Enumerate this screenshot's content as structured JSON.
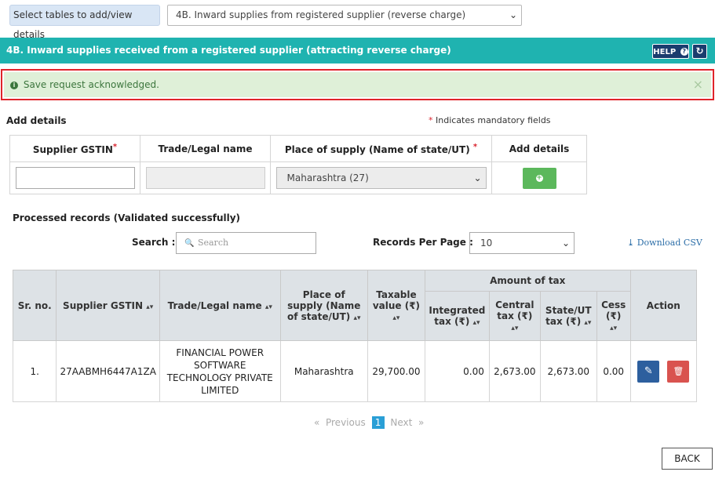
{
  "table_selector": {
    "label": "Select tables to add/view details",
    "selected": "4B. Inward supplies from registered supplier (reverse charge)"
  },
  "header": {
    "title": "4B. Inward supplies received from a registered supplier (attracting reverse charge)",
    "help_label": "HELP",
    "help_icon_glyph": "?",
    "refresh_glyph": "↻"
  },
  "alert": {
    "icon_glyph": "i",
    "message": "Save request acknowledged.",
    "close_glyph": "×"
  },
  "add_section": {
    "title": "Add details",
    "mandatory_star": "*",
    "mandatory_note": "Indicates mandatory fields",
    "columns": {
      "supplier_gstin": "Supplier GSTIN",
      "trade_name": "Trade/Legal name",
      "place_of_supply": "Place of supply (Name of state/UT)",
      "add_details": "Add details"
    },
    "supplier_gstin_value": "",
    "trade_name_value": "",
    "place_of_supply_selected": "Maharashtra (27)",
    "add_glyph": "+"
  },
  "processed": {
    "title": "Processed records (Validated successfully)",
    "search_label": "Search :",
    "search_placeholder": "Search",
    "search_glyph": "🔍",
    "rpp_label": "Records Per Page :",
    "rpp_selected": "10",
    "download_label": "Download CSV",
    "download_glyph": "⤓",
    "sort_glyph": "▴▾",
    "columns": {
      "sr_no": "Sr. no.",
      "supplier_gstin": "Supplier GSTIN",
      "trade_name": "Trade/Legal name",
      "place_of_supply": "Place of supply (Name of state/UT)",
      "taxable_value": "Taxable value (₹)",
      "amount_of_tax": "Amount of tax",
      "integrated_tax": "Integrated tax (₹)",
      "central_tax": "Central tax (₹)",
      "state_ut_tax": "State/UT tax (₹)",
      "cess": "Cess (₹)",
      "action": "Action"
    },
    "rows": [
      {
        "sr_no": "1.",
        "supplier_gstin": "27AABMH6447A1ZA",
        "trade_name": "FINANCIAL POWER SOFTWARE TECHNOLOGY PRIVATE LIMITED",
        "place_of_supply": "Maharashtra",
        "taxable_value": "29,700.00",
        "integrated_tax": "0.00",
        "central_tax": "2,673.00",
        "state_ut_tax": "2,673.00",
        "cess": "0.00",
        "edit_glyph": "✎",
        "delete_glyph": "🗑"
      }
    ]
  },
  "pagination": {
    "first_glyph": "«",
    "previous": "Previous",
    "current": "1",
    "next": "Next",
    "last_glyph": "»"
  },
  "back_label": "BACK"
}
